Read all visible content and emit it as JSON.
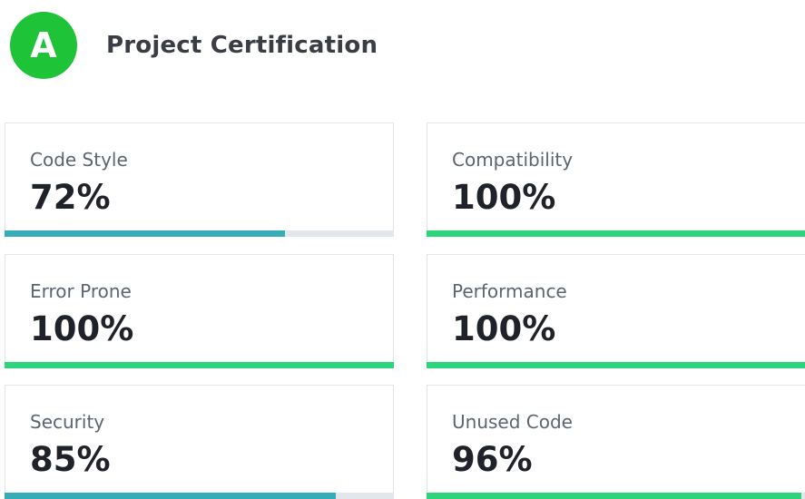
{
  "header": {
    "grade": "A",
    "grade_color": "#1fc337",
    "title": "Project Certification"
  },
  "metrics": [
    {
      "label": "Code Style",
      "value": "72%",
      "fraction": 0.72,
      "bar_color": "#35acb8"
    },
    {
      "label": "Compatibility",
      "value": "100%",
      "fraction": 1.0,
      "bar_color": "#2ed47a"
    },
    {
      "label": "Error Prone",
      "value": "100%",
      "fraction": 1.0,
      "bar_color": "#2ed47a"
    },
    {
      "label": "Performance",
      "value": "100%",
      "fraction": 1.0,
      "bar_color": "#2ed47a"
    },
    {
      "label": "Security",
      "value": "85%",
      "fraction": 0.85,
      "bar_color": "#35acb8"
    },
    {
      "label": "Unused Code",
      "value": "96%",
      "fraction": 0.96,
      "bar_color": "#2ed47a"
    }
  ]
}
